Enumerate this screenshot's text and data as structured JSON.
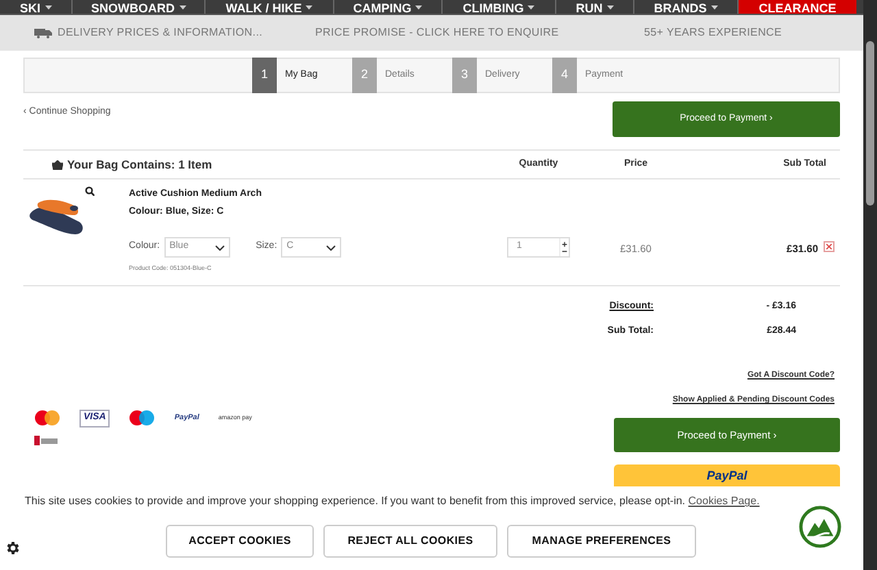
{
  "nav": [
    {
      "label": "SKI",
      "kind": "menu"
    },
    {
      "label": "SNOWBOARD",
      "kind": "menu"
    },
    {
      "label": "WALK / HIKE",
      "kind": "menu"
    },
    {
      "label": "CAMPING",
      "kind": "menu"
    },
    {
      "label": "CLIMBING",
      "kind": "menu"
    },
    {
      "label": "RUN",
      "kind": "menu"
    },
    {
      "label": "BRANDS",
      "kind": "menu"
    },
    {
      "label": "CLEARANCE",
      "kind": "sale"
    }
  ],
  "info_bar": [
    "DELIVERY PRICES & INFORMATION...",
    "PRICE PROMISE - CLICK HERE TO ENQUIRE",
    "55+ YEARS EXPERIENCE"
  ],
  "steps": [
    {
      "number": "1",
      "label": "My Bag",
      "selected": true
    },
    {
      "number": "2",
      "label": "Details",
      "selected": false
    },
    {
      "number": "3",
      "label": "Delivery",
      "selected": false
    },
    {
      "number": "4",
      "label": "Payment",
      "selected": false
    }
  ],
  "continue_link": "‹ Continue Shopping",
  "proceed_button": "Proceed to Payment ›",
  "bag": {
    "title": "Your Bag Contains: 1 Item",
    "columns": [
      "Quantity",
      "Price",
      "Sub Total"
    ],
    "items": [
      {
        "name": "Active Cushion Medium Arch",
        "variant": "Colour: Blue, Size: C",
        "colour_label": "Colour:",
        "colour": "Blue",
        "size_label": "Size:",
        "size": "C",
        "product_code": "Product Code: 051304-Blue-C",
        "quantity": "1",
        "price": "£31.60",
        "subtotal": "£31.60"
      }
    ]
  },
  "totals": [
    {
      "label": "Discount:",
      "value": "- £3.16",
      "kind": "link"
    },
    {
      "label": "Sub Total:",
      "value": "£28.44",
      "kind": "plain"
    }
  ],
  "discount_links": [
    "Got A Discount Code?",
    "Show Applied & Pending Discount Codes"
  ],
  "payment_logos": [
    {
      "kind": "mastercard"
    },
    {
      "kind": "visa",
      "text": "VISA"
    },
    {
      "kind": "maestro"
    },
    {
      "kind": "paypal",
      "text": "PayPal"
    },
    {
      "kind": "amazon",
      "text": "amazon pay"
    }
  ],
  "checkout_button": "Proceed to Payment ›",
  "paypal_button": "PayPal",
  "cookie_banner": {
    "text": "This site uses cookies to provide and improve your shopping experience. If you want to benefit from this improved service, please opt-in.",
    "link": "Cookies Page.",
    "buttons": [
      "ACCEPT COOKIES",
      "REJECT ALL COOKIES",
      "MANAGE PREFERENCES"
    ]
  }
}
